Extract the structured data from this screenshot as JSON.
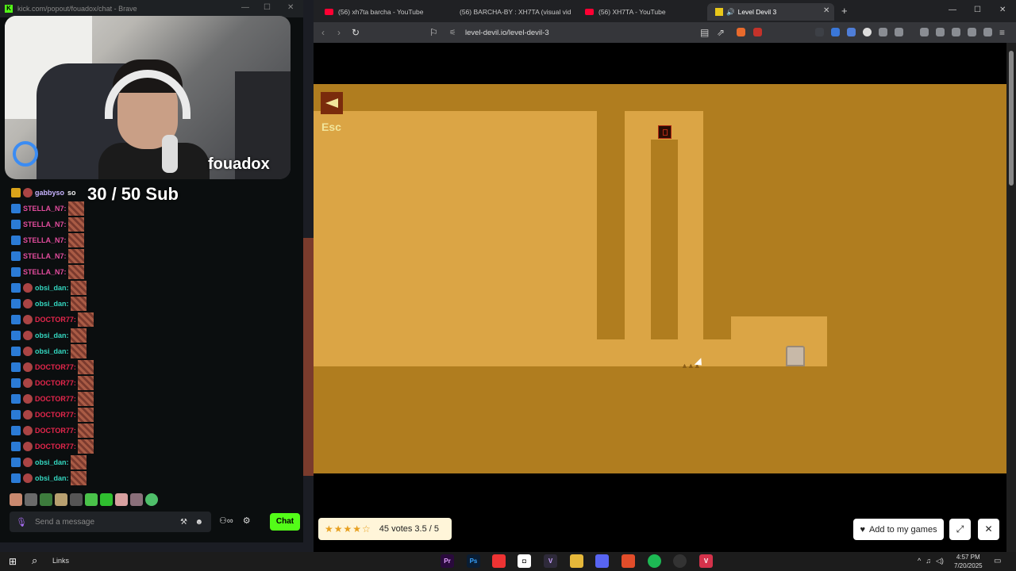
{
  "kick": {
    "window_title": "kick.com/popout/fouadox/chat - Brave",
    "streamer": "fouadox",
    "sub_goal": "30  / 50 Sub",
    "chat": [
      {
        "user": "gabbyso",
        "msg": "so",
        "type": "gabby"
      },
      {
        "user": "STELLA_N7:",
        "type": "stella"
      },
      {
        "user": "STELLA_N7:",
        "type": "stella"
      },
      {
        "user": "STELLA_N7:",
        "type": "stella"
      },
      {
        "user": "STELLA_N7:",
        "type": "stella"
      },
      {
        "user": "STELLA_N7:",
        "type": "stella"
      },
      {
        "user": "obsi_dan:",
        "type": "obsi"
      },
      {
        "user": "obsi_dan:",
        "type": "obsi"
      },
      {
        "user": "DOCTOR77:",
        "type": "doctor"
      },
      {
        "user": "obsi_dan:",
        "type": "obsi"
      },
      {
        "user": "obsi_dan:",
        "type": "obsi"
      },
      {
        "user": "DOCTOR77:",
        "type": "doctor"
      },
      {
        "user": "DOCTOR77:",
        "type": "doctor"
      },
      {
        "user": "DOCTOR77:",
        "type": "doctor"
      },
      {
        "user": "DOCTOR77:",
        "type": "doctor"
      },
      {
        "user": "DOCTOR77:",
        "type": "doctor"
      },
      {
        "user": "DOCTOR77:",
        "type": "doctor"
      },
      {
        "user": "obsi_dan:",
        "type": "obsi"
      },
      {
        "user": "obsi_dan:",
        "type": "obsi"
      }
    ],
    "input_placeholder": "Send a message",
    "chat_button": "Chat",
    "viewers_icon": "∞"
  },
  "browser": {
    "tabs": [
      {
        "label": "(56) xh7ta barcha - YouTube"
      },
      {
        "label": "(56) BARCHA-BY : XH7TA (visual vide"
      },
      {
        "label": "(56) XH7TA - YouTube"
      },
      {
        "label": "Level Devil 3",
        "active": true
      }
    ],
    "url": "level-devil.io/level-devil-3"
  },
  "game": {
    "esc_label": "Esc",
    "rating_text": "45 votes 3.5 / 5",
    "rating_stars": "★★★★☆",
    "add_games": "Add to my games",
    "colors": {
      "dark": "#b07d1f",
      "light": "#dba545"
    }
  },
  "taskbar": {
    "links": "Links",
    "time": "4:57 PM",
    "date": "7/20/2025"
  }
}
